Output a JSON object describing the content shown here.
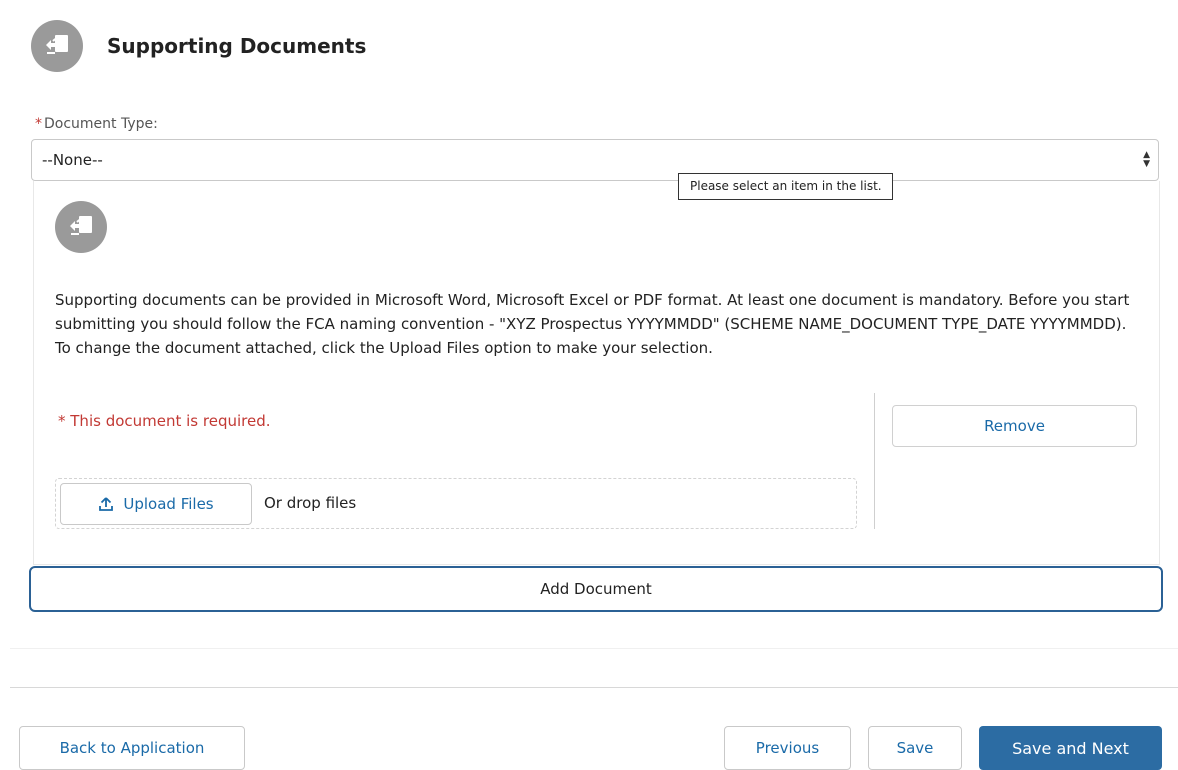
{
  "header": {
    "title": "Supporting Documents",
    "icon": "document-upload-icon"
  },
  "document_type": {
    "label": "Document Type:",
    "required_marker": "*",
    "selected": "--None--",
    "tooltip": "Please select an item in the list."
  },
  "panel": {
    "icon": "document-upload-icon",
    "description": "Supporting documents can be provided in Microsoft Word, Microsoft Excel or PDF format. At least one document is mandatory. Before you start submitting you should follow the FCA naming convention - \"XYZ Prospectus YYYYMMDD\" (SCHEME NAME_DOCUMENT TYPE_DATE YYYYMMDD). To change the document attached, click the Upload Files option to make your selection.",
    "required_text": "* This document is required.",
    "remove_label": "Remove",
    "upload_label": "Upload Files",
    "drop_text": "Or drop files"
  },
  "add_document_label": "Add Document",
  "footer": {
    "back_label": "Back to Application",
    "previous_label": "Previous",
    "save_label": "Save",
    "save_next_label": "Save and Next"
  },
  "colors": {
    "accent": "#2c6ca3",
    "link": "#1a6aa8",
    "error": "#c23934",
    "icon_bg": "#9a9a9a"
  }
}
